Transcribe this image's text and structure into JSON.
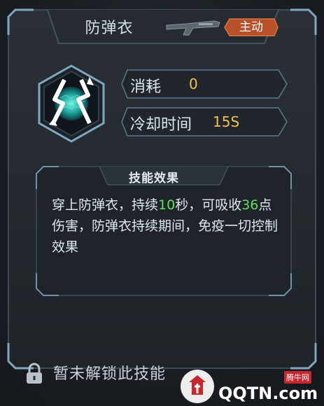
{
  "skill": {
    "name": "防弹衣",
    "type_badge": "主动",
    "icon": "shield-skill-icon",
    "weapon_icon": "shotgun-icon"
  },
  "stats": {
    "cost_label": "消耗",
    "cost_value": "0",
    "cooldown_label": "冷却时间",
    "cooldown_value": "15S"
  },
  "effect": {
    "title": "技能效果",
    "text_1": "穿上防弹衣，持续",
    "duration": "10",
    "text_2": "秒，可吸收",
    "absorb": "36",
    "text_3": "点伤害，防弹衣持续期间，免疫一切控制效果"
  },
  "lock": {
    "label": "暂未解锁此技能"
  },
  "watermark": {
    "brand": "QQTN.com",
    "site": "腾牛网"
  },
  "colors": {
    "accent_value": "#f2c14e",
    "highlight": "#5fe05a",
    "badge": "#b8512a",
    "frame": "#5a7a8c"
  }
}
